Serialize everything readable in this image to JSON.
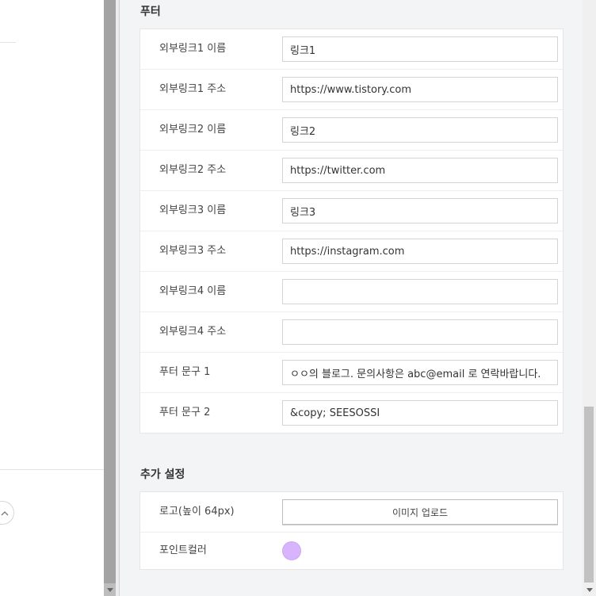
{
  "footer_section": {
    "title": "푸터",
    "rows": [
      {
        "label": "외부링크1 이름",
        "value": "링크1"
      },
      {
        "label": "외부링크1 주소",
        "value": "https://www.tistory.com"
      },
      {
        "label": "외부링크2 이름",
        "value": "링크2"
      },
      {
        "label": "외부링크2 주소",
        "value": "https://twitter.com"
      },
      {
        "label": "외부링크3 이름",
        "value": "링크3"
      },
      {
        "label": "외부링크3 주소",
        "value": "https://instagram.com"
      },
      {
        "label": "외부링크4 이름",
        "value": ""
      },
      {
        "label": "외부링크4 주소",
        "value": ""
      },
      {
        "label": "푸터 문구 1",
        "value": "ㅇㅇ의 블로그. 문의사항은 abc@email 로 연락바랍니다."
      },
      {
        "label": "푸터 문구 2",
        "value": "&copy; SEESOSSI"
      }
    ]
  },
  "extra_section": {
    "title": "추가 설정",
    "logo_label": "로고(높이 64px)",
    "upload_button_label": "이미지 업로드",
    "point_color_label": "포인트컬러",
    "point_color": "#d8b4fe"
  },
  "icons": {
    "collapse": "chevron-up-icon",
    "scroll_down": "triangle-down-icon"
  }
}
